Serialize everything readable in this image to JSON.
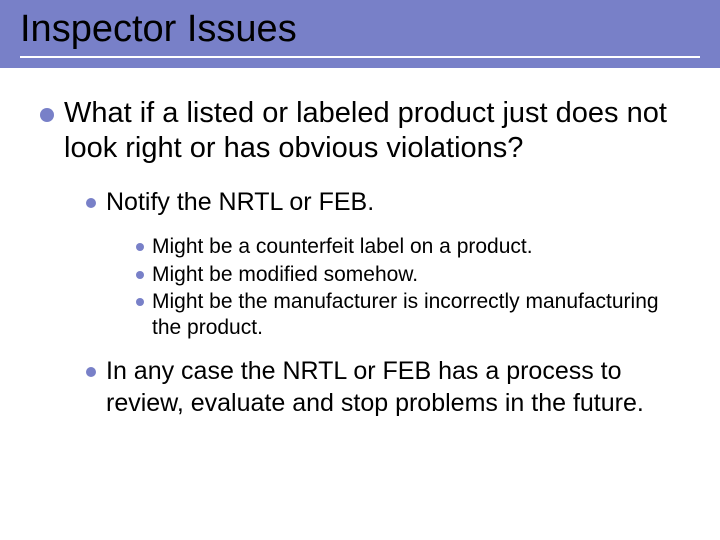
{
  "colors": {
    "band": "#7880c8",
    "bullet": "#7880c8"
  },
  "slide": {
    "title": "Inspector Issues",
    "bullets": {
      "level1": {
        "text": "What if a listed or labeled product just does not look right or has obvious violations?"
      },
      "level2a": {
        "text": "Notify the NRTL or FEB."
      },
      "level3": [
        {
          "text": "Might be a counterfeit label on a product."
        },
        {
          "text": "Might be modified somehow."
        },
        {
          "text": "Might be the manufacturer is incorrectly manufacturing the product."
        }
      ],
      "level2b": {
        "text": "In any case the NRTL or FEB has a process to review, evaluate and stop problems in the future."
      }
    }
  }
}
